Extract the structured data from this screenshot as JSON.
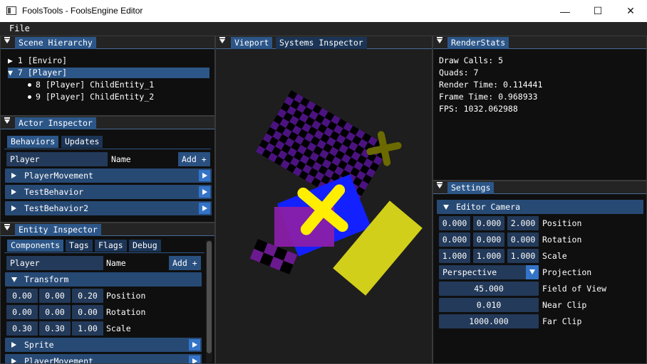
{
  "window": {
    "title": "FoolsTools - FoolsEngine Editor",
    "minimize": "—",
    "maximize": "☐",
    "close": "✕"
  },
  "menu": {
    "file": "File"
  },
  "scene_hierarchy": {
    "title": "Scene Hierarchy",
    "items": [
      {
        "label": "1 [Enviro]",
        "state": "collapsed"
      },
      {
        "label": "7 [Player]",
        "state": "expanded"
      },
      {
        "label": "8 [Player] ChildEntity_1",
        "state": "leaf"
      },
      {
        "label": "9 [Player] ChildEntity_2",
        "state": "leaf"
      }
    ]
  },
  "actor_inspector": {
    "title": "Actor Inspector",
    "tabs": [
      "Behaviors",
      "Updates"
    ],
    "name_value": "Player",
    "name_label": "Name",
    "add_label": "Add +",
    "behaviors": [
      "PlayerMovement",
      "TestBehavior",
      "TestBehavior2"
    ]
  },
  "entity_inspector": {
    "title": "Entity Inspector",
    "tabs": [
      "Components",
      "Tags",
      "Flags",
      "Debug"
    ],
    "name_value": "Player",
    "name_label": "Name",
    "add_label": "Add +",
    "transform_label": "Transform",
    "position": [
      "0.00",
      "0.00",
      "0.20"
    ],
    "position_label": "Position",
    "rotation": [
      "0.00",
      "0.00",
      "0.00"
    ],
    "rotation_label": "Rotation",
    "scale": [
      "0.30",
      "0.30",
      "1.00"
    ],
    "scale_label": "Scale",
    "components": [
      "Sprite",
      "PlayerMovement"
    ]
  },
  "viewport": {
    "tabs": [
      "Vieport",
      "Systems Inspector"
    ]
  },
  "render_stats": {
    "title": "RenderStats",
    "lines": [
      "Draw Calls: 5",
      "Quads: 7",
      "Render Time: 0.114441",
      "Frame Time: 0.968933",
      "FPS: 1032.062988"
    ]
  },
  "settings": {
    "title": "Settings",
    "camera_label": "Editor Camera",
    "position": [
      "0.000",
      "0.000",
      "2.000"
    ],
    "position_label": "Position",
    "rotation": [
      "0.000",
      "0.000",
      "0.000"
    ],
    "rotation_label": "Rotation",
    "scale": [
      "1.000",
      "1.000",
      "1.000"
    ],
    "scale_label": "Scale",
    "projection_value": "Perspective",
    "projection_label": "Projection",
    "fov_value": "45.000",
    "fov_label": "Field of View",
    "near_value": "0.010",
    "near_label": "Near Clip",
    "far_value": "1000.000",
    "far_label": "Far Clip"
  },
  "colors": {
    "accent": "#2c5688",
    "frame": "#233a5a",
    "header": "#274a75",
    "button": "#3474c8",
    "bg": "#0f0f0f"
  }
}
